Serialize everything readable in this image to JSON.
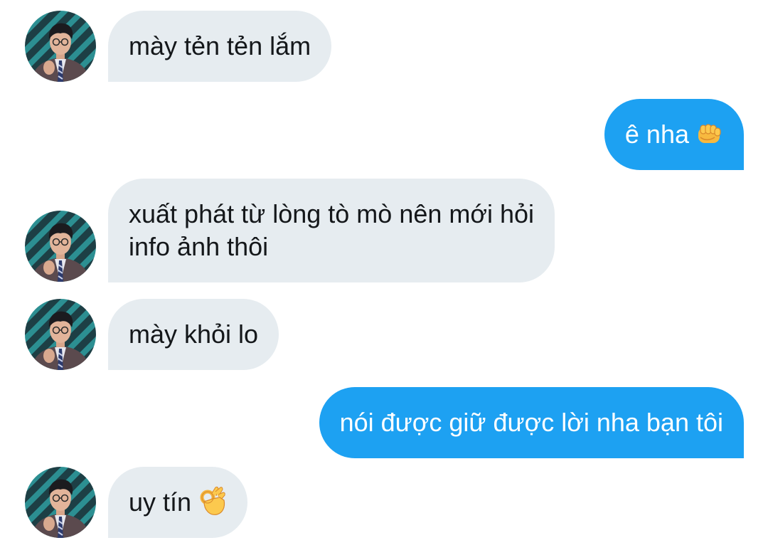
{
  "messages": [
    {
      "side": "received",
      "text": "mày tẻn tẻn lắm"
    },
    {
      "side": "sent",
      "text": "ê nha",
      "emoji": "oncoming-fist-icon"
    },
    {
      "side": "received",
      "text_lines": [
        "xuất phát từ lòng tò mò nên mới hỏi",
        "info ảnh thôi"
      ]
    },
    {
      "side": "received",
      "text": "mày khỏi lo"
    },
    {
      "side": "sent",
      "text": "nói được giữ được lời nha bạn tôi"
    },
    {
      "side": "received",
      "text": "uy tín",
      "emoji": "ok-hand-icon"
    }
  ],
  "colors": {
    "received_bubble": "#e6ecf0",
    "received_text": "#14171a",
    "sent_bubble": "#1da1f2",
    "sent_text": "#ffffff"
  },
  "avatar_icon": "user-photo-avatar"
}
